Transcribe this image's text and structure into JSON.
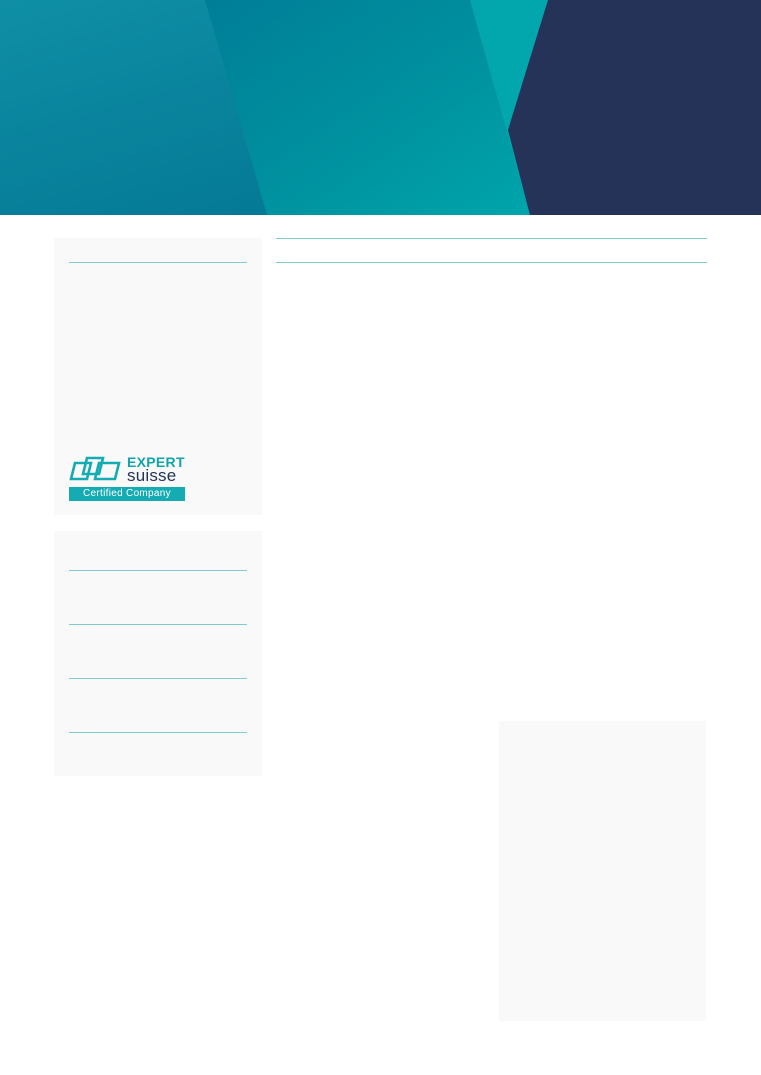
{
  "colors": {
    "teal": "#0aa6ac",
    "teal_dark": "#006d8c",
    "navy": "#253358",
    "rule": "#7fcbd1",
    "panel_bg": "#f9f9f9"
  },
  "certification": {
    "brand_line1": "EXPERT",
    "brand_line2": "suisse",
    "badge_text": "Certified Company",
    "icon": "expertsuisse-logo-icon"
  }
}
